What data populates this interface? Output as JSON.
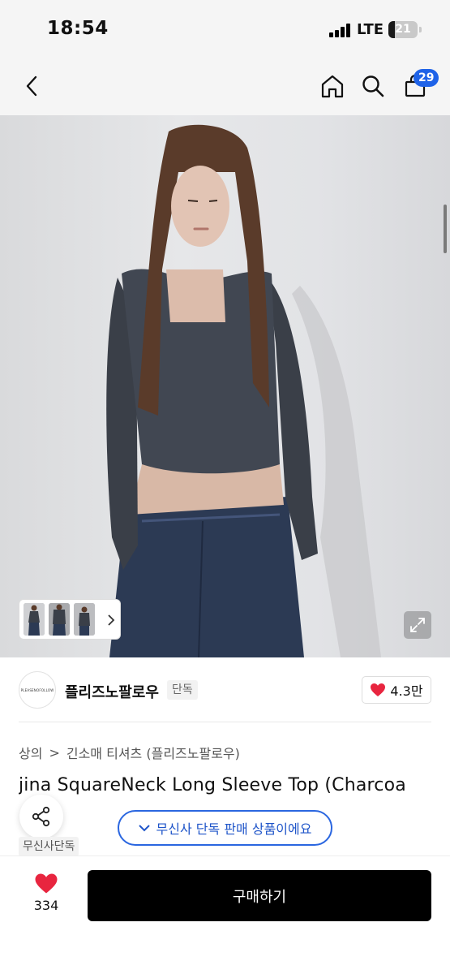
{
  "status_bar": {
    "time": "18:54",
    "network": "LTE",
    "battery": "21",
    "battery_level": 0.21
  },
  "header": {
    "cart_count": "29"
  },
  "brand": {
    "logo_text": "PLEASENOFOLLOW",
    "name": "플리즈노팔로우",
    "tag": "단독",
    "likes": "4.3만"
  },
  "breadcrumb": {
    "root": "상의",
    "separator": ">",
    "current": "긴소매 티셔츠 (플리즈노팔로우)"
  },
  "product": {
    "title": "jina SquareNeck Long Sleeve Top (Charcoa",
    "exclusive_tag": "무신사단독",
    "exclusive_pill": "무신사 단독 판매 상품이에요"
  },
  "bottom": {
    "wish_count": "334",
    "buy_label": "구매하기"
  },
  "colors": {
    "accent": "#1f63e8",
    "heart": "#e8253f",
    "buy_button": "#000000"
  }
}
